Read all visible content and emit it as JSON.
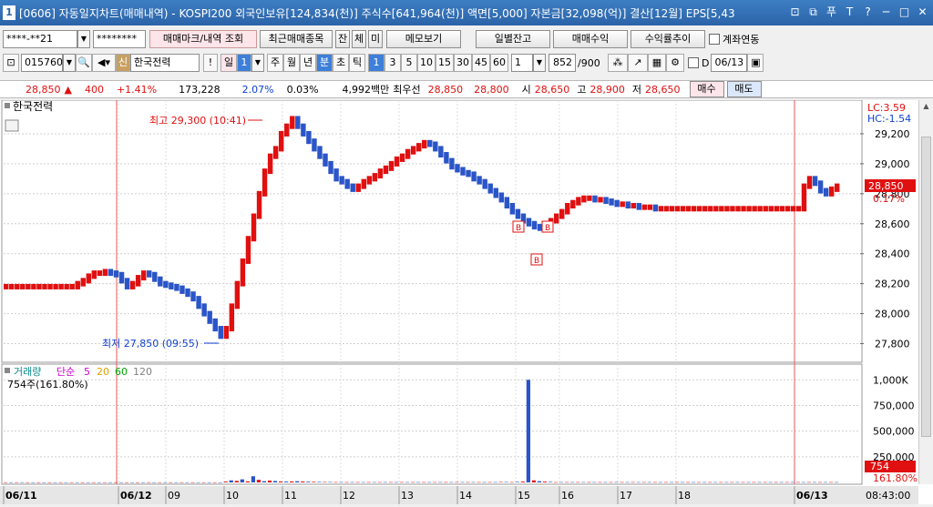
{
  "titlebar": {
    "num": "1",
    "title": "[0606] 자동일지차트(매매내역) - KOSPI200 외국인보유[124,834(천)] 주식수[641,964(천)] 액면[5,000] 자본금[32,098(억)] 결산[12월] EPS[5,43",
    "controls": [
      "⊡",
      "⧉",
      "푸",
      "T",
      "?",
      "─",
      "□",
      "✕"
    ]
  },
  "toolbar1": {
    "account": "****-**21",
    "password": "********",
    "btn_trade_mark": "매매마크/내역 조회",
    "btn_recent": "최근매매종목",
    "btn_jan": "잔",
    "btn_che": "체",
    "btn_mi": "미",
    "btn_memo": "메모보기",
    "btn_daily": "일별잔고",
    "btn_profit": "매매수익",
    "btn_return": "수익률추이",
    "acct_link_label": "계좌연동"
  },
  "toolbar2": {
    "code": "015760",
    "badge": "신",
    "stock_name": "한국전력",
    "excl": "!",
    "period_label": "일",
    "period_num": "1",
    "periods": [
      "주",
      "월",
      "년",
      "분",
      "초",
      "틱"
    ],
    "active_period": "분",
    "intervals": [
      "1",
      "3",
      "5",
      "10",
      "15",
      "30",
      "45",
      "60"
    ],
    "active_interval": "1",
    "count": "1",
    "page": "852",
    "page_total": "/900",
    "d_label": "D",
    "date": "06/13"
  },
  "quote": {
    "price": "28,850",
    "arrow": "▲",
    "change": "400",
    "change_pct": "+1.41%",
    "volume": "173,228",
    "vol_pct": "2.07%",
    "turnover": "0.03%",
    "amount": "4,992백만",
    "best_label": "최우선",
    "ask": "28,850",
    "bid": "28,800",
    "open_label": "시",
    "open": "28,650",
    "high_label": "고",
    "high": "28,900",
    "low_label": "저",
    "low": "28,650",
    "buy_btn": "매수",
    "sell_btn": "매도"
  },
  "price_pane": {
    "legend": "한국전력",
    "lc": "LC:3.59",
    "hc": "HC:-1.54",
    "high_note": "최고 29,300 (10:41)",
    "low_note": "최저 27,850 (09:55)",
    "cur_price": "28,850",
    "cur_pct": "0.17%",
    "trade_marker": "B"
  },
  "volume_pane": {
    "legend_label": "거래량",
    "ma_label": "단순",
    "ma": [
      "5",
      "20",
      "60",
      "120"
    ],
    "ma_colors": [
      "#d000d0",
      "#e0a000",
      "#00a000",
      "#808080"
    ],
    "info": "754주(161.80%)",
    "cur_vol": "754",
    "cur_vol_pct": "161.80%"
  },
  "time_axis": {
    "labels": [
      "06/11",
      "06/12",
      "09",
      "10",
      "11",
      "12",
      "13",
      "14",
      "15",
      "16",
      "17",
      "18",
      "06/13"
    ],
    "clock": "08:43:00"
  },
  "chart_data": [
    {
      "type": "line",
      "title": "한국전력",
      "ylim": [
        27700,
        29400
      ],
      "yticks": [
        "29,200",
        "29,000",
        "28,800",
        "28,600",
        "28,400",
        "28,200",
        "28,000",
        "27,800"
      ],
      "series": [
        {
          "name": "한국전력",
          "values": [
            28180,
            28180,
            28180,
            28180,
            28180,
            28180,
            28180,
            28180,
            28180,
            28180,
            28180,
            28180,
            28180,
            28200,
            28220,
            28250,
            28270,
            28270,
            28280,
            28270,
            28260,
            28220,
            28180,
            28200,
            28240,
            28270,
            28260,
            28230,
            28200,
            28190,
            28180,
            28170,
            28150,
            28130,
            28100,
            28050,
            28000,
            27950,
            27900,
            27850,
            27900,
            28050,
            28200,
            28350,
            28500,
            28650,
            28800,
            28950,
            29050,
            29100,
            29200,
            29250,
            29300,
            29250,
            29200,
            29150,
            29100,
            29050,
            29000,
            28950,
            28900,
            28880,
            28850,
            28830,
            28850,
            28880,
            28900,
            28920,
            28950,
            28970,
            29000,
            29030,
            29050,
            29080,
            29100,
            29120,
            29140,
            29130,
            29100,
            29060,
            29020,
            28980,
            28960,
            28940,
            28930,
            28900,
            28880,
            28850,
            28820,
            28790,
            28760,
            28720,
            28680,
            28650,
            28620,
            28600,
            28580,
            28570,
            28580,
            28620,
            28650,
            28680,
            28720,
            28740,
            28760,
            28770,
            28770,
            28760,
            28760,
            28750,
            28740,
            28730,
            28730,
            28720,
            28720,
            28710,
            28710,
            28710,
            28700,
            28700,
            28700,
            28700,
            28700,
            28700,
            28700,
            28700,
            28700,
            28700,
            28700,
            28700,
            28700,
            28700,
            28700,
            28700,
            28700,
            28700,
            28700,
            28700,
            28700,
            28700,
            28700,
            28700,
            28700,
            28700,
            28700,
            28850,
            28900,
            28870,
            28820,
            28800,
            28830,
            28850
          ]
        }
      ]
    },
    {
      "type": "bar",
      "title": "거래량",
      "ylim": [
        0,
        1100000
      ],
      "yticks": [
        "1,000K",
        "750,000",
        "500,000",
        "250,000"
      ],
      "series": [
        {
          "name": "거래량",
          "values": [
            1000,
            1000,
            1000,
            1000,
            1000,
            1000,
            1000,
            1000,
            1000,
            1000,
            1000,
            1000,
            1000,
            1000,
            1000,
            1000,
            1000,
            1000,
            1000,
            1000,
            1000,
            1000,
            1000,
            1000,
            1000,
            1000,
            1000,
            1000,
            1000,
            1000,
            1000,
            1000,
            1000,
            1000,
            1000,
            1000,
            1000,
            1000,
            1000,
            1000,
            8000,
            20000,
            15000,
            30000,
            10000,
            60000,
            25000,
            12000,
            18000,
            14000,
            9000,
            8000,
            10000,
            12000,
            9000,
            7000,
            6000,
            5000,
            4000,
            4000,
            3000,
            3000,
            3000,
            3000,
            3000,
            3000,
            3000,
            3000,
            3000,
            3000,
            3000,
            3000,
            3000,
            3000,
            3000,
            3000,
            3000,
            3000,
            3000,
            3000,
            3000,
            3000,
            3000,
            3000,
            3000,
            3000,
            3000,
            3000,
            3000,
            3000,
            4000,
            4000,
            3000,
            5000,
            8000,
            1000000,
            20000,
            12000,
            8000,
            5000,
            3000,
            3000,
            3000,
            3000,
            3000,
            3000,
            3000,
            3000,
            3000,
            3000,
            3000,
            3000,
            3000,
            3000,
            3000,
            3000,
            3000,
            3000,
            3000,
            3000,
            3000,
            3000,
            3000,
            3000,
            3000,
            3000,
            3000,
            3000,
            3000,
            3000,
            3000,
            3000,
            3000,
            3000,
            3000,
            3000,
            3000,
            3000,
            3000,
            3000,
            3000,
            3000,
            3000,
            3000,
            3000,
            3000,
            3000,
            3000,
            3000,
            3000,
            3000,
            3000
          ]
        }
      ]
    }
  ]
}
